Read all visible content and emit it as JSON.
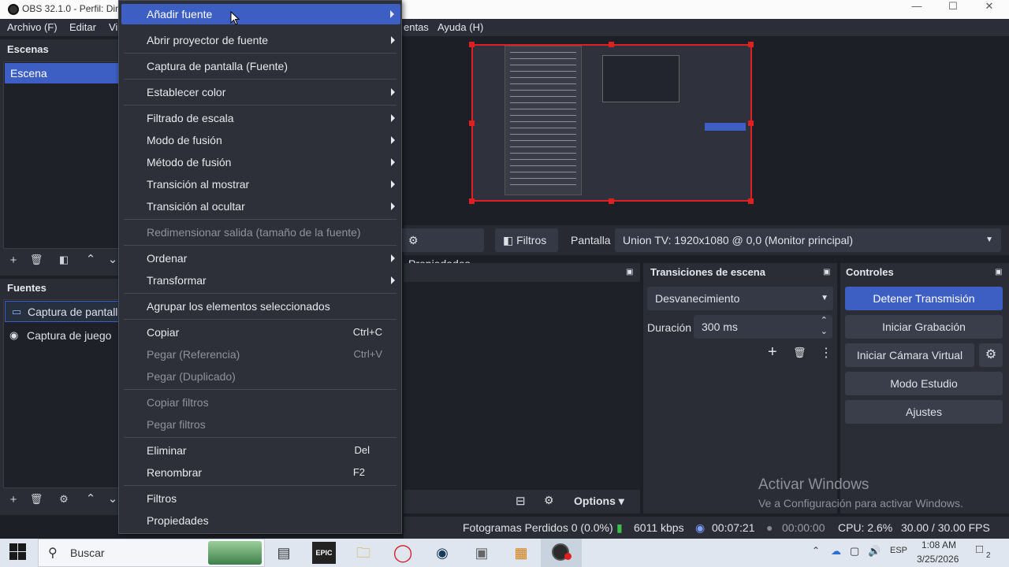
{
  "window": {
    "title": "OBS 32.1.0 - Perfil: Dire"
  },
  "menubar": {
    "items": [
      "Archivo (F)",
      "Editar",
      "Vi",
      "entas",
      "Ayuda (H)"
    ]
  },
  "scenes": {
    "title": "Escenas",
    "items": [
      "Escena"
    ]
  },
  "sources": {
    "title": "Fuentes",
    "items": [
      "Captura de pantalla",
      "Captura de juego"
    ]
  },
  "context_menu": {
    "items": [
      {
        "label": "Añadir fuente",
        "submenu": true,
        "highlighted": true
      },
      {
        "label": "Abrir proyector de fuente",
        "submenu": true
      },
      {
        "label": "Captura de pantalla (Fuente)"
      },
      {
        "label": "Establecer color",
        "submenu": true
      },
      {
        "label": "Filtrado de escala",
        "submenu": true
      },
      {
        "label": "Modo de fusión",
        "submenu": true
      },
      {
        "label": "Método de fusión",
        "submenu": true
      },
      {
        "label": "Transición al mostrar",
        "submenu": true
      },
      {
        "label": "Transición al ocultar",
        "submenu": true
      },
      {
        "label": "Redimensionar salida (tamaño de la fuente)",
        "disabled": true
      },
      {
        "label": "Ordenar",
        "submenu": true
      },
      {
        "label": "Transformar",
        "submenu": true
      },
      {
        "label": "Agrupar los elementos seleccionados"
      },
      {
        "label": "Copiar",
        "shortcut": "Ctrl+C"
      },
      {
        "label": "Pegar (Referencia)",
        "shortcut": "Ctrl+V",
        "disabled": true
      },
      {
        "label": "Pegar (Duplicado)",
        "disabled": true
      },
      {
        "label": "Copiar filtros",
        "disabled": true
      },
      {
        "label": "Pegar filtros",
        "disabled": true
      },
      {
        "label": "Eliminar",
        "shortcut": "Del"
      },
      {
        "label": "Renombrar",
        "shortcut": "F2"
      },
      {
        "label": "Filtros"
      },
      {
        "label": "Propiedades"
      }
    ]
  },
  "source_toolbar": {
    "properties": "Propiedades",
    "filters": "Filtros",
    "display_label": "Pantalla",
    "display_value": "Union TV: 1920x1080 @ 0,0 (Monitor principal)"
  },
  "transitions": {
    "title": "Transiciones de escena",
    "type": "Desvanecimiento",
    "duration_label": "Duración",
    "duration_value": "300 ms"
  },
  "controls": {
    "title": "Controles",
    "buttons": [
      "Detener Transmisión",
      "Iniciar Grabación",
      "Iniciar Cámara Virtual",
      "Modo Estudio",
      "Ajustes"
    ]
  },
  "mixer": {
    "options": "Options"
  },
  "watermark": {
    "line1": "Activar Windows",
    "line2": "Ve a Configuración para activar Windows."
  },
  "status": {
    "dropped": "Fotogramas Perdidos 0 (0.0%)",
    "bitrate": "6011 kbps",
    "stream_time": "00:07:21",
    "rec_time": "00:00:00",
    "cpu": "CPU: 2.6%",
    "fps": "30.00 / 30.00 FPS"
  },
  "taskbar": {
    "search_placeholder": "Buscar",
    "lang": "ESP",
    "time": "1:08 AM",
    "date": "3/25/2026",
    "notif_count": "2"
  },
  "colors": {
    "accent": "#3d5fc4",
    "selection_border": "#e02020"
  }
}
